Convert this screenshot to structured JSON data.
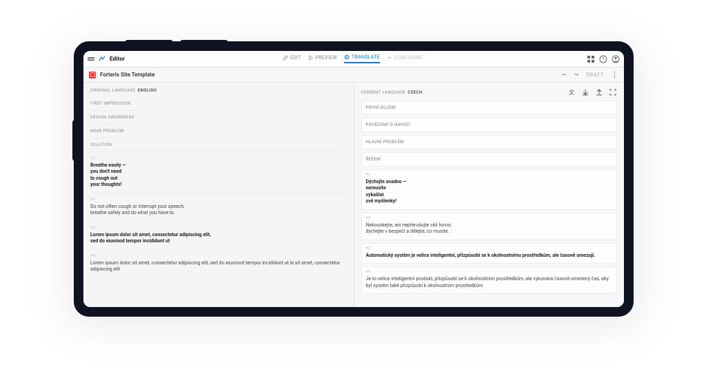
{
  "app": {
    "title": "Editor"
  },
  "tabs": {
    "edit": "EDIT",
    "preview": "PREVIEW",
    "translate": "TRANSLATE",
    "configure": "CONFIGURE",
    "active": "translate"
  },
  "secondbar": {
    "file_name": "Forteris Site Template",
    "status": "DRAFT"
  },
  "left": {
    "lang_label": "ORIGINAL LANGUAGE",
    "lang": "ENGLISH",
    "blocks": [
      "FIRST IMPRESSION",
      "DESIGN AWARENESS",
      "MAIN PROBLEM",
      "SOLUTION"
    ],
    "items": [
      {
        "tag": "H2",
        "strong": true,
        "text": "Breathe easily —\nyou don't need\nto cough out\nyour thoughts!"
      },
      {
        "tag": "H5",
        "strong": false,
        "text": "Do not often cough or interrupt your speech,\nbreathe safely and do what you have to."
      },
      {
        "tag": "H3",
        "strong": true,
        "text": "Lorem ipsum dolor sit amet, consectetur adipiscing elit,\nsed do eiusmod tempor incididunt ut"
      },
      {
        "tag": "H4",
        "strong": false,
        "text": "Lorem ipsum dolor sit amet, consectetur adipiscing elit, sed do eiusmod tempor incididunt ut la sit amet, consectetur adipiscing elit"
      }
    ]
  },
  "right": {
    "lang_label": "CURRENT LANGUAGE",
    "lang": "CZECH",
    "blocks": [
      "PRVNÍ DOJEM",
      "POVĚDOMÍ O NÁVRZI",
      "HLAVNÍ PROBLÉM",
      "ŘEŠENÍ"
    ],
    "items": [
      {
        "tag": "H2",
        "strong": true,
        "text": "Dýchejte snadno —\nnemusíte\nvykašlat\nsvé myšlenky!"
      },
      {
        "tag": "H5",
        "strong": false,
        "text": "Nekouskejte, ani nepřerušujte váš hovor,\ndýchejte v bezpečí a dělejte, co musíte."
      },
      {
        "tag": "H3",
        "strong": true,
        "text": "Automatický systém je velice inteligentní, přizpůsobí se k okolnostnímu prostředkům, ale časově omezují."
      },
      {
        "tag": "H4",
        "strong": false,
        "text": "Je to velice inteligentní produkt, přizpůsobí se k okolnostním prostředkům, ale vykonává časově omezený čas, aby byl systém také přizpůsobí k okolnostním prostředkům"
      }
    ]
  }
}
